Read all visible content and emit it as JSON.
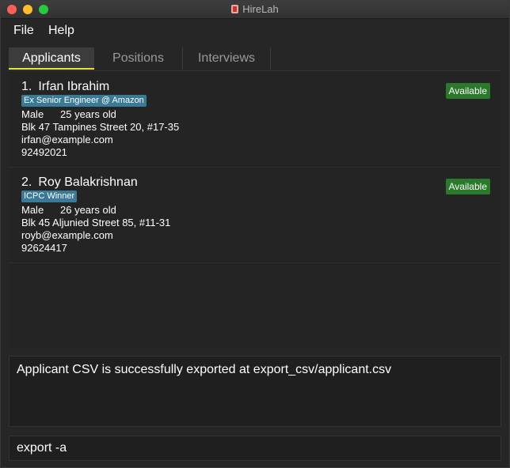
{
  "window": {
    "title": "HireLah"
  },
  "menu": {
    "file": "File",
    "help": "Help"
  },
  "tabs": [
    "Applicants",
    "Positions",
    "Interviews"
  ],
  "applicants": [
    {
      "index": "1.",
      "name": "Irfan Ibrahim",
      "tag": "Ex Senior Engineer @ Amazon",
      "status": "Available",
      "gender": "Male",
      "age": "25 years old",
      "address": "Blk 47 Tampines Street 20, #17-35",
      "email": "irfan@example.com",
      "phone": "92492021"
    },
    {
      "index": "2.",
      "name": "Roy Balakrishnan",
      "tag": "ICPC Winner",
      "status": "Available",
      "gender": "Male",
      "age": "26 years old",
      "address": "Blk 45 Aljunied Street 85, #11-31",
      "email": "royb@example.com",
      "phone": "92624417"
    }
  ],
  "result": {
    "message": "Applicant CSV is successfully exported at export_csv/applicant.csv"
  },
  "command": {
    "value": "export -a"
  },
  "colors": {
    "active_tab_underline": "#e6e33b",
    "tag": "#3a7a96",
    "status_available": "#2b7a2b",
    "background": "#262626"
  }
}
